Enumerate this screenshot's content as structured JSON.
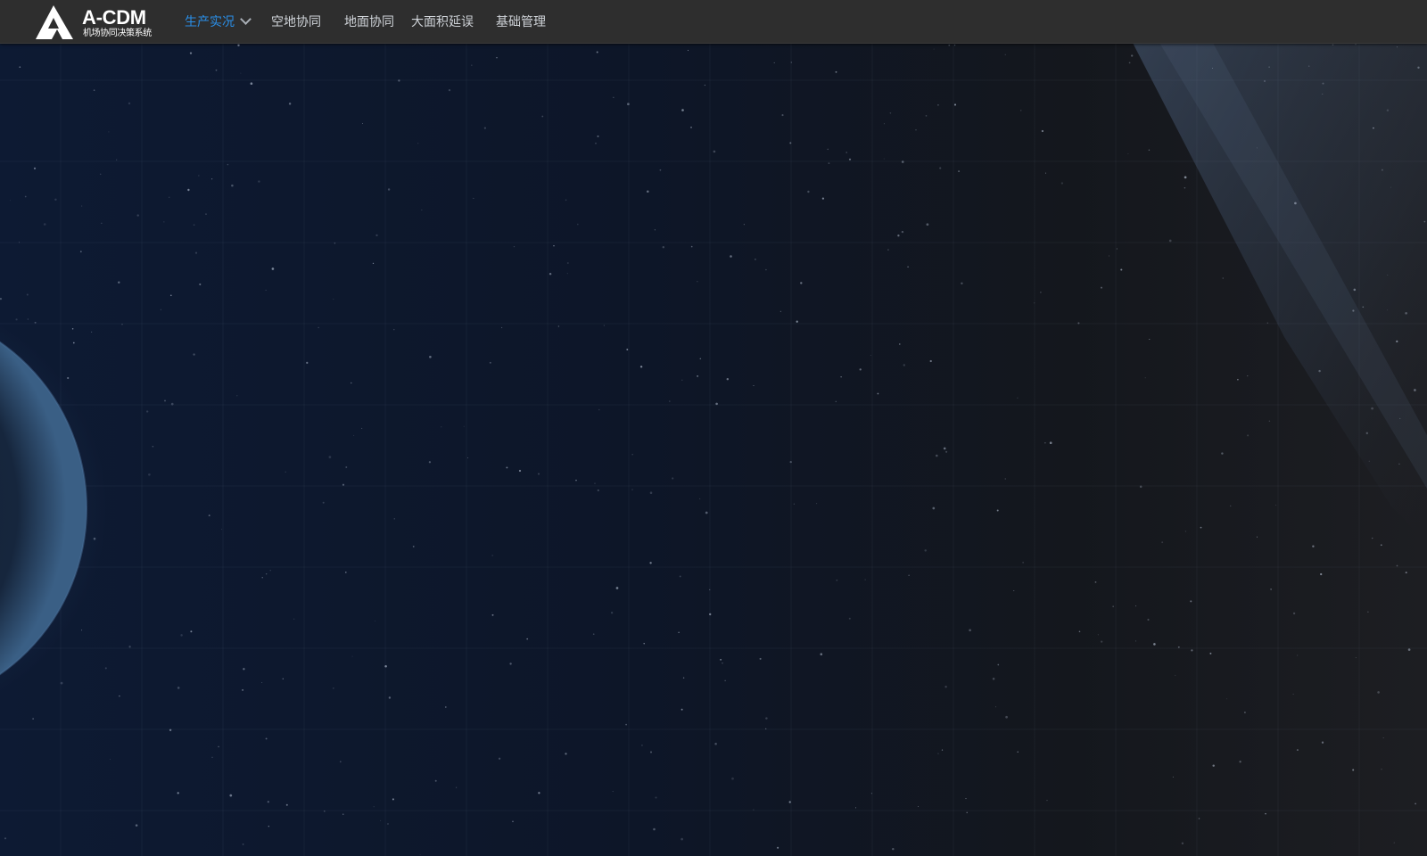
{
  "header": {
    "logo": {
      "title": "A-CDM",
      "subtitle": "机场协同决策系统"
    },
    "nav": [
      {
        "label": "生产实况",
        "active": true,
        "has_dropdown": true,
        "icon": "chevron-down-icon"
      },
      {
        "label": "空地协同",
        "active": false
      },
      {
        "label": "地面协同",
        "active": false
      },
      {
        "label": "大面积延误",
        "active": false
      },
      {
        "label": "基础管理",
        "active": false
      }
    ]
  },
  "background": {
    "description_icon": "starfield-earth-background",
    "colors": {
      "header_bg": "#2e2e2e",
      "active_nav": "#2a8fe8",
      "nav_text": "#cfd3d8",
      "space_dark": "#0b1120"
    }
  }
}
